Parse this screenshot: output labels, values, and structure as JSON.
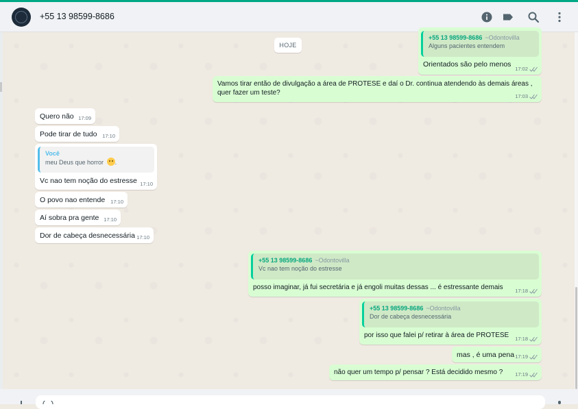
{
  "header": {
    "contact_name": "+55 13 98599-8686",
    "icons": [
      "info-icon",
      "label-icon",
      "search-icon",
      "menu-dots-icon"
    ]
  },
  "day_badge": "HOJE",
  "messages": [
    {
      "dir": "out",
      "quote_author": "+55 13 98599-8686",
      "quote_alias": "~Odontovilla",
      "quote_text": "Alguns pacientes entendem",
      "text": "Orientados são pelo menos",
      "time": "17:02"
    },
    {
      "dir": "out",
      "text": "Vamos tirar então de divulgação a área de PROTESE e daí o Dr. continua atendendo às demais áreas , quer fazer um teste?",
      "time": "17:03"
    },
    {
      "dir": "in",
      "text": "Quero não",
      "time": "17:09"
    },
    {
      "dir": "in",
      "text": "Pode tirar de tudo",
      "time": "17:10"
    },
    {
      "dir": "in",
      "quote_author": "Você",
      "quote_text": "meu Deus que horror",
      "text": "Vc nao tem noção do estresse",
      "time": "17:10"
    },
    {
      "dir": "in",
      "text": "O povo nao entende",
      "time": "17:10"
    },
    {
      "dir": "in",
      "text": "Aí sobra pra gente",
      "time": "17:10"
    },
    {
      "dir": "in",
      "text": "Dor de cabeça desnecessária",
      "time": "17:10"
    },
    {
      "dir": "out",
      "quote_author": "+55 13 98599-8686",
      "quote_alias": "~Odontovilla",
      "quote_text": "Vc nao tem noção do estresse",
      "text": "posso imaginar, já fui secretária e já engoli muitas dessas ... é estressante demais",
      "time": "17:18"
    },
    {
      "dir": "out",
      "quote_author": "+55 13 98599-8686",
      "quote_alias": "~Odontovilla",
      "quote_text": "Dor de cabeça desnecessária",
      "text": "por isso que falei p/ retirar à área de PROTESE",
      "time": "17:18"
    },
    {
      "dir": "out",
      "text": "mas , é uma pena",
      "time": "17:19"
    },
    {
      "dir": "out",
      "text": "não quer um tempo p/ pensar ? Está decidido mesmo ?",
      "time": "17:19"
    }
  ],
  "colors": {
    "accent": "#00a884",
    "outgoing_bubble": "#d9fdd3",
    "incoming_bubble": "#ffffff",
    "chat_background": "#efeae2",
    "read_ticks": "#8696a0"
  }
}
